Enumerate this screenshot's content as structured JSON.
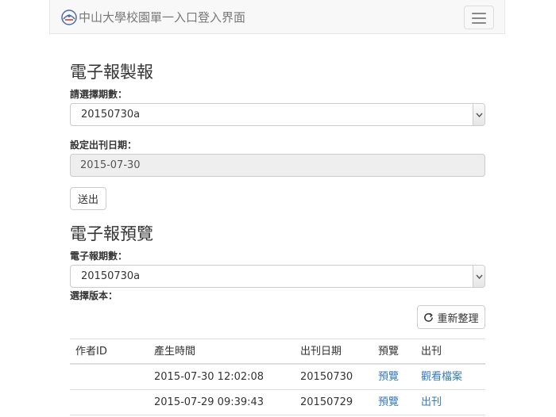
{
  "navbar": {
    "brand_title": "中山大學校園單一入口登入界面",
    "brand_logo_icon": "nsysu-logo-icon",
    "toggle_icon": "hamburger-menu-icon"
  },
  "publish_section": {
    "heading": "電子報製報",
    "issue_label": "請選擇期數：",
    "issue_selected": "20150730a",
    "date_label": "設定出刊日期：",
    "date_value": "2015-07-30",
    "submit_label": "送出"
  },
  "preview_section": {
    "heading": "電子報預覽",
    "issue_label": "電子報期數：",
    "issue_selected": "20150730a",
    "version_label": "選擇版本：",
    "refresh_label": "重新整理",
    "refresh_icon": "refresh-icon"
  },
  "table": {
    "headers": [
      "作者ID",
      "產生時間",
      "出刊日期",
      "預覽",
      "出刊"
    ],
    "rows": [
      {
        "author": "",
        "created": "2015-07-30 12:02:08",
        "publish_date": "20150730",
        "preview": "預覽",
        "action": "觀看檔案"
      },
      {
        "author": "",
        "created": "2015-07-29 09:39:43",
        "publish_date": "20150729",
        "preview": "預覽",
        "action": "出刊"
      }
    ]
  },
  "colors": {
    "link": "#337ab7",
    "navbar_bg": "#f8f8f8",
    "disabled_input_bg": "#eeeeee"
  }
}
